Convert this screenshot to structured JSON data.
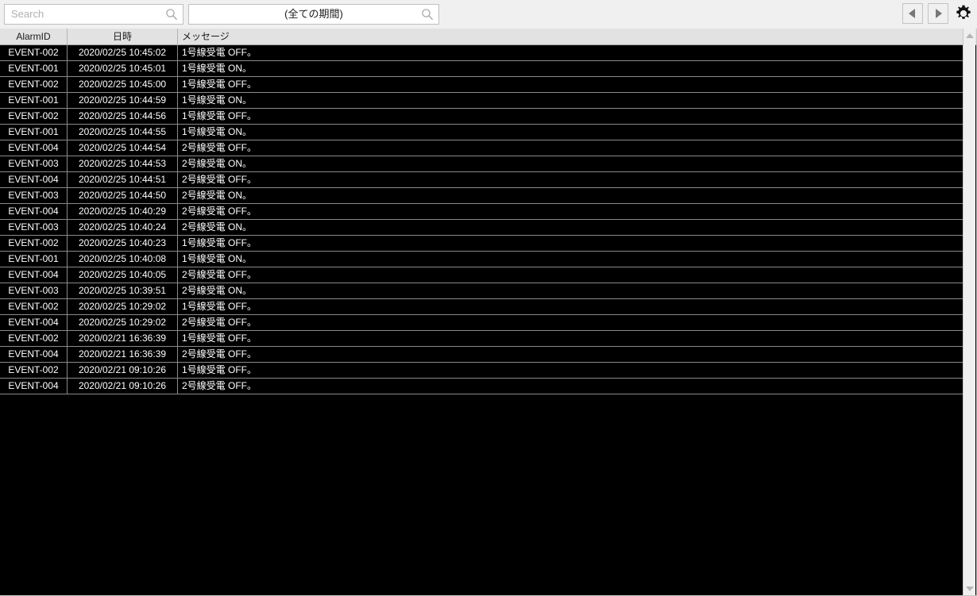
{
  "toolbar": {
    "search": {
      "placeholder": "Search",
      "value": "",
      "icon": "search-icon"
    },
    "period": {
      "value": "(全ての期間)",
      "icon": "search-icon"
    },
    "prev_button": {
      "icon": "triangle-left-icon",
      "label": ""
    },
    "next_button": {
      "icon": "triangle-right-icon",
      "label": ""
    },
    "settings_button": {
      "icon": "gear-icon",
      "label": ""
    }
  },
  "table": {
    "columns": [
      {
        "key": "alarm_id",
        "label": "AlarmID"
      },
      {
        "key": "datetime",
        "label": "日時"
      },
      {
        "key": "message",
        "label": "メッセージ"
      }
    ],
    "rows": [
      {
        "alarm_id": "EVENT-002",
        "datetime": "2020/02/25 10:45:02",
        "message": "1号線受電 OFF。"
      },
      {
        "alarm_id": "EVENT-001",
        "datetime": "2020/02/25 10:45:01",
        "message": "1号線受電 ON。"
      },
      {
        "alarm_id": "EVENT-002",
        "datetime": "2020/02/25 10:45:00",
        "message": "1号線受電 OFF。"
      },
      {
        "alarm_id": "EVENT-001",
        "datetime": "2020/02/25 10:44:59",
        "message": "1号線受電 ON。"
      },
      {
        "alarm_id": "EVENT-002",
        "datetime": "2020/02/25 10:44:56",
        "message": "1号線受電 OFF。"
      },
      {
        "alarm_id": "EVENT-001",
        "datetime": "2020/02/25 10:44:55",
        "message": "1号線受電 ON。"
      },
      {
        "alarm_id": "EVENT-004",
        "datetime": "2020/02/25 10:44:54",
        "message": "2号線受電 OFF。"
      },
      {
        "alarm_id": "EVENT-003",
        "datetime": "2020/02/25 10:44:53",
        "message": "2号線受電 ON。"
      },
      {
        "alarm_id": "EVENT-004",
        "datetime": "2020/02/25 10:44:51",
        "message": "2号線受電 OFF。"
      },
      {
        "alarm_id": "EVENT-003",
        "datetime": "2020/02/25 10:44:50",
        "message": "2号線受電 ON。"
      },
      {
        "alarm_id": "EVENT-004",
        "datetime": "2020/02/25 10:40:29",
        "message": "2号線受電 OFF。"
      },
      {
        "alarm_id": "EVENT-003",
        "datetime": "2020/02/25 10:40:24",
        "message": "2号線受電 ON。"
      },
      {
        "alarm_id": "EVENT-002",
        "datetime": "2020/02/25 10:40:23",
        "message": "1号線受電 OFF。"
      },
      {
        "alarm_id": "EVENT-001",
        "datetime": "2020/02/25 10:40:08",
        "message": "1号線受電 ON。"
      },
      {
        "alarm_id": "EVENT-004",
        "datetime": "2020/02/25 10:40:05",
        "message": "2号線受電 OFF。"
      },
      {
        "alarm_id": "EVENT-003",
        "datetime": "2020/02/25 10:39:51",
        "message": "2号線受電 ON。"
      },
      {
        "alarm_id": "EVENT-002",
        "datetime": "2020/02/25 10:29:02",
        "message": "1号線受電 OFF。"
      },
      {
        "alarm_id": "EVENT-004",
        "datetime": "2020/02/25 10:29:02",
        "message": "2号線受電 OFF。"
      },
      {
        "alarm_id": "EVENT-002",
        "datetime": "2020/02/21 16:36:39",
        "message": "1号線受電 OFF。"
      },
      {
        "alarm_id": "EVENT-004",
        "datetime": "2020/02/21 16:36:39",
        "message": "2号線受電 OFF。"
      },
      {
        "alarm_id": "EVENT-002",
        "datetime": "2020/02/21 09:10:26",
        "message": "1号線受電 OFF。"
      },
      {
        "alarm_id": "EVENT-004",
        "datetime": "2020/02/21 09:10:26",
        "message": "2号線受電 OFF。"
      }
    ]
  },
  "scrollbar": {
    "up_icon": "triangle-up-icon",
    "down_icon": "triangle-down-icon"
  },
  "colors": {
    "toolbar_bg": "#f0f0f0",
    "grid_bg": "#000000",
    "grid_text": "#ffffff",
    "grid_line": "#8a8a8a",
    "header_bg": "#e2e2e2",
    "header_text": "#1a1a1a"
  }
}
